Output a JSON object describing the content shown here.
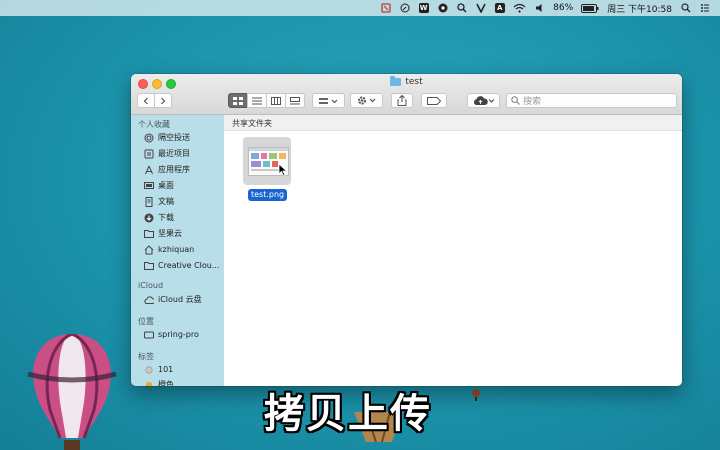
{
  "menubar": {
    "items": [
      "tool-icon",
      "compass-icon",
      "w-app-icon",
      "paint-icon",
      "search-app-icon",
      "v-app-icon",
      "a-app-icon",
      "wifi-icon",
      "volume-icon"
    ],
    "a_icon_label": "A",
    "w_icon_label": "W",
    "battery": "86%",
    "clock": "周三 下午10:58"
  },
  "window": {
    "title": "test",
    "search_placeholder": "搜索",
    "path_title": "共享文件夹"
  },
  "sidebar": {
    "favorites_header": "个人收藏",
    "favorites": [
      {
        "label": "隔空投送",
        "icon": "airdrop-icon"
      },
      {
        "label": "最近项目",
        "icon": "recents-icon"
      },
      {
        "label": "应用程序",
        "icon": "applications-icon"
      },
      {
        "label": "桌面",
        "icon": "desktop-icon"
      },
      {
        "label": "文稿",
        "icon": "documents-icon"
      },
      {
        "label": "下载",
        "icon": "downloads-icon"
      },
      {
        "label": "坚果云",
        "icon": "folder-icon"
      },
      {
        "label": "kzhiquan",
        "icon": "home-icon"
      },
      {
        "label": "Creative Clou...",
        "icon": "folder-icon"
      }
    ],
    "icloud_header": "iCloud",
    "icloud": [
      {
        "label": "iCloud 云盘",
        "icon": "cloud-icon"
      }
    ],
    "locations_header": "位置",
    "locations": [
      {
        "label": "spring-pro",
        "icon": "drive-icon"
      }
    ],
    "tags_header": "标签",
    "tags": [
      {
        "label": "101",
        "color": "#b0b0b0"
      },
      {
        "label": "橙色",
        "color": "#f5a623"
      }
    ]
  },
  "files": [
    {
      "name": "test.png",
      "selected": true
    }
  ],
  "caption": "拷贝上传",
  "colors": {
    "desktop": "#1b93ab",
    "selection": "#1a64d2",
    "sidebar": "#b2dbe8"
  }
}
